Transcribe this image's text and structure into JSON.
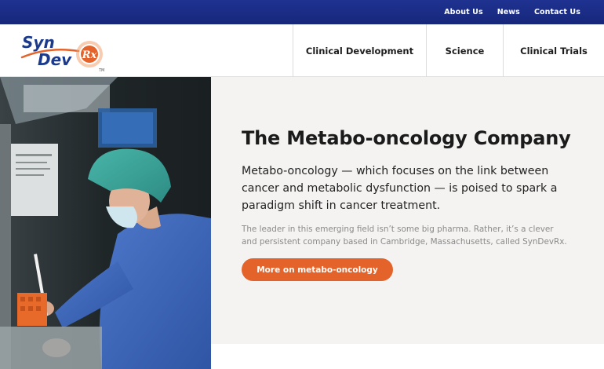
{
  "topbar": {
    "links": [
      "About Us",
      "News",
      "Contact Us"
    ]
  },
  "header": {
    "logo": {
      "line1": "Syn",
      "line2": "Dev",
      "badge": "Rx",
      "tm": "TM"
    },
    "nav": [
      "Clinical Development",
      "Science",
      "Clinical Trials"
    ]
  },
  "hero": {
    "title": "The Metabo-oncology Company",
    "lead": "Metabo-oncology — which focuses on the link between cancer and metabolic dysfunction — is poised to spark a paradigm shift in cancer treatment.",
    "body": "The leader in this emerging field isn’t some big pharma. Rather, it’s a clever and persistent company based in Cambridge, Massachusetts, called SynDevRx.",
    "cta_label": "More on metabo-oncology"
  },
  "colors": {
    "topbar": "#1f3291",
    "brand_blue": "#1b3a8c",
    "accent_orange": "#e4632a",
    "panel_bg": "#f4f3f2"
  }
}
